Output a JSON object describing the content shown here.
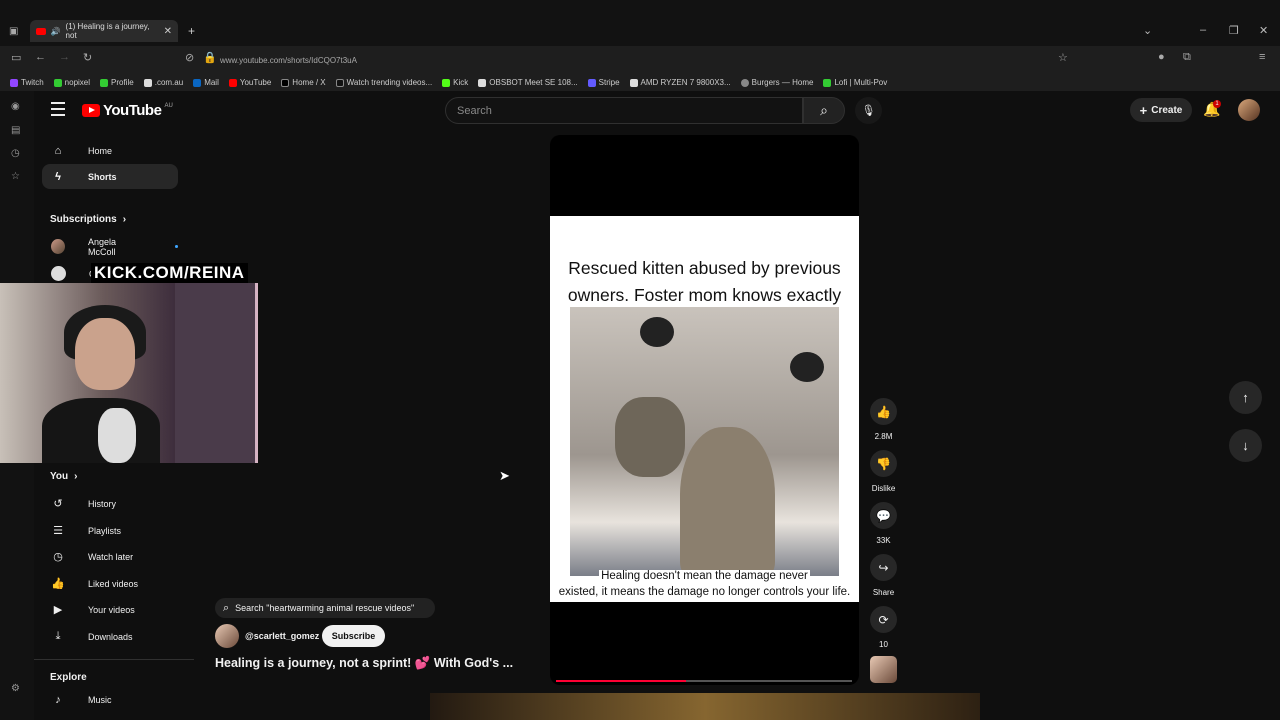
{
  "browser": {
    "tab_title": "(1) Healing is a journey, not",
    "url": "www.youtube.com/shorts/IdCQO7t3uA",
    "bookmarks": [
      "Twitch",
      "nopixel",
      "Profile",
      ".com.au",
      "Mail",
      "YouTube",
      "Home / X",
      "Watch trending videos...",
      "Kick",
      "OBSBOT Meet SE 108...",
      "Stripe",
      "AMD RYZEN 7 9800X3...",
      "Burgers — Home",
      "Lofi | Multi-Pov"
    ]
  },
  "header": {
    "logo_text": "YouTube",
    "region": "AU",
    "search_placeholder": "Search",
    "create_label": "Create",
    "notification_count": "1"
  },
  "sidebar": {
    "home": "Home",
    "shorts": "Shorts",
    "subscriptions": "Subscriptions",
    "sub1": "Angela McColl",
    "sub2": "Ou",
    "you": "You",
    "history": "History",
    "playlists": "Playlists",
    "watch_later": "Watch later",
    "liked": "Liked videos",
    "your_videos": "Your videos",
    "downloads": "Downloads",
    "explore": "Explore",
    "music": "Music"
  },
  "overlay": {
    "kick_text": "KICK.COM/REINA"
  },
  "short": {
    "caption_top": "Rescued kitten abused by previous owners. Foster mom knows exactly what to do.😭",
    "caption_bottom_1": "Healing doesn't mean the damage never",
    "caption_bottom_2": "existed, it means the damage no longer controls your life.",
    "search_chip": "Search \"heartwarming animal rescue videos\"",
    "channel": "@scarlett_gomez",
    "subscribe": "Subscribe",
    "title": "Healing is a journey, not a sprint! 💕 With God's ...",
    "progress": 0.44
  },
  "actions": {
    "likes": "2.8M",
    "dislike": "Dislike",
    "comments": "33K",
    "share": "Share",
    "remix": "10"
  }
}
